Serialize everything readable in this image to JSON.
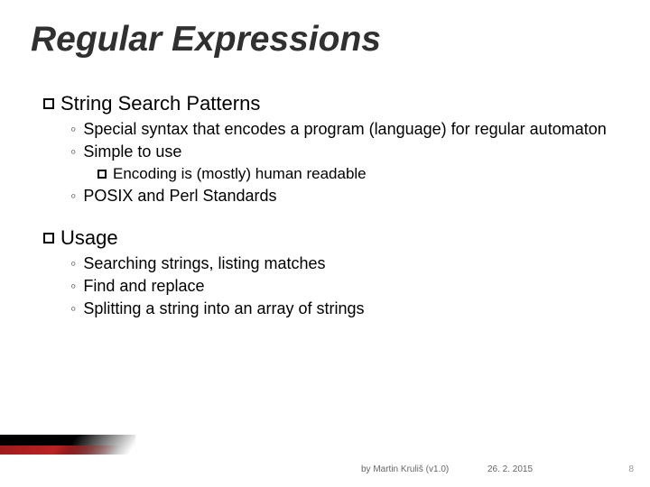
{
  "title": "Regular Expressions",
  "sections": [
    {
      "heading": "String Search Patterns",
      "items": [
        {
          "text": "Special syntax that encodes a program (language) for regular automaton"
        },
        {
          "text": "Simple to use",
          "sub": [
            {
              "text": "Encoding is (mostly) human readable"
            }
          ]
        },
        {
          "text": "POSIX and Perl Standards"
        }
      ]
    },
    {
      "heading": "Usage",
      "items": [
        {
          "text": "Searching strings, listing matches"
        },
        {
          "text": "Find and replace"
        },
        {
          "text": "Splitting a string into an array of strings"
        }
      ]
    }
  ],
  "footer": {
    "byline": "by Martin Kruliš (v1.0)",
    "date": "26. 2. 2015",
    "page": "8"
  }
}
